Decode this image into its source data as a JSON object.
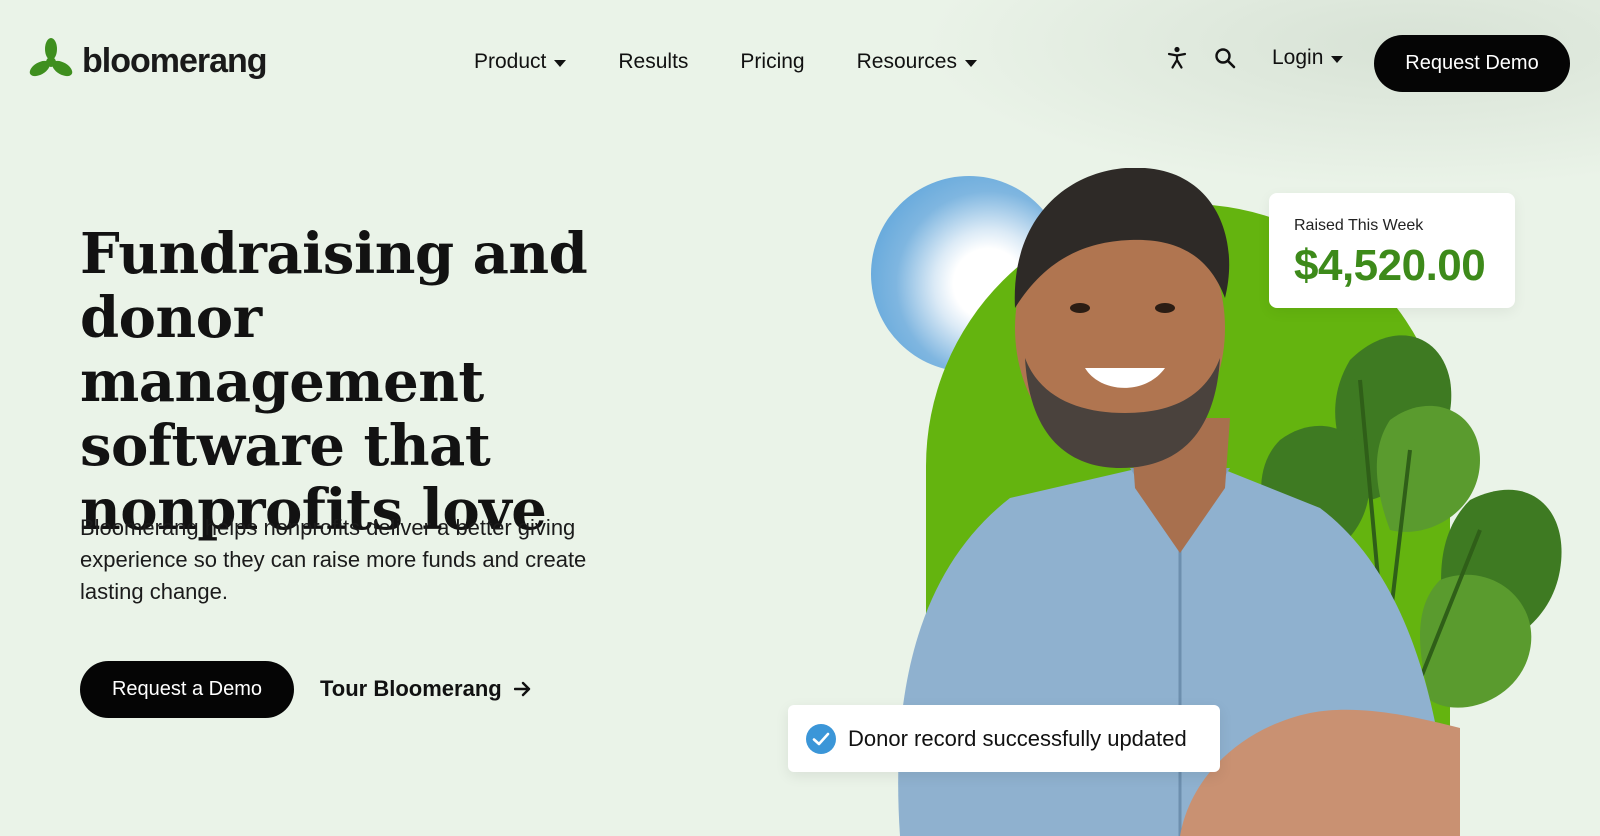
{
  "brand": {
    "name": "bloomerang",
    "accent_green": "#64b40f",
    "dark_green": "#3d8a1a"
  },
  "nav": {
    "items": [
      {
        "label": "Product",
        "has_dropdown": true
      },
      {
        "label": "Results",
        "has_dropdown": false
      },
      {
        "label": "Pricing",
        "has_dropdown": false
      },
      {
        "label": "Resources",
        "has_dropdown": true
      }
    ],
    "accessibility_icon": "accessibility-icon",
    "search_icon": "search-icon",
    "login_label": "Login",
    "cta_label": "Request Demo"
  },
  "hero": {
    "headline": "Fundraising and donor management software that nonprofits love",
    "subtext": "Bloomerang helps nonprofits deliver a better giving experience so they can raise more funds and create lasting change.",
    "primary_cta": "Request a Demo",
    "secondary_cta": "Tour Bloomerang"
  },
  "raised_card": {
    "label": "Raised This Week",
    "amount": "$4,520.00"
  },
  "toast": {
    "message": "Donor record successfully updated",
    "icon": "check-circle-icon"
  }
}
